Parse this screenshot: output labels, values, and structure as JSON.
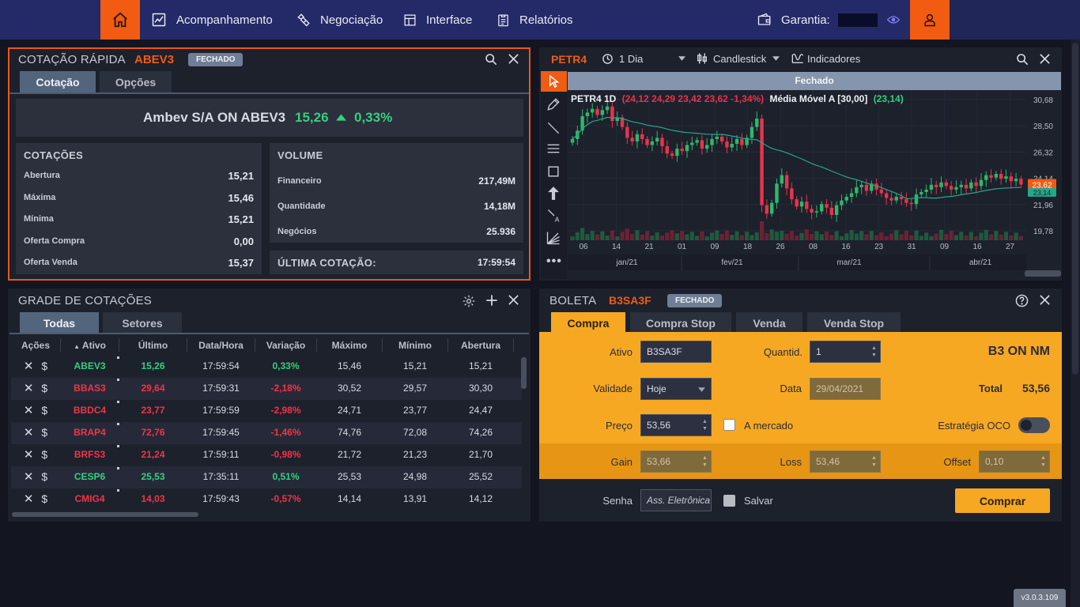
{
  "nav": {
    "items": [
      {
        "label": "Acompanhamento",
        "icon": "chart-icon"
      },
      {
        "label": "Negociação",
        "icon": "handshake-icon"
      },
      {
        "label": "Interface",
        "icon": "layout-icon"
      },
      {
        "label": "Relatórios",
        "icon": "report-icon"
      }
    ],
    "garantia_label": "Garantia:"
  },
  "quick_quote": {
    "title": "COTAÇÃO RÁPIDA",
    "ticker": "ABEV3",
    "status": "FECHADO",
    "tabs": [
      "Cotação",
      "Opções"
    ],
    "name": "Ambev S/A ON ABEV3",
    "price": "15,26",
    "change": "0,33%",
    "quotes_header": "COTAÇÕES",
    "quotes": [
      {
        "label": "Abertura",
        "value": "15,21"
      },
      {
        "label": "Máxima",
        "value": "15,46"
      },
      {
        "label": "Mínima",
        "value": "15,21"
      },
      {
        "label": "Oferta Compra",
        "value": "0,00"
      },
      {
        "label": "Oferta Venda",
        "value": "15,37"
      }
    ],
    "volume_header": "VOLUME",
    "volume": [
      {
        "label": "Financeiro",
        "value": "217,49M"
      },
      {
        "label": "Quantidade",
        "value": "14,18M"
      },
      {
        "label": "Negócios",
        "value": "25.936"
      }
    ],
    "last_label": "ÚLTIMA COTAÇÃO:",
    "last_time": "17:59:54"
  },
  "grid": {
    "title": "GRADE DE COTAÇÕES",
    "tabs": [
      "Todas",
      "Setores"
    ],
    "columns": [
      "Ações",
      "Ativo",
      "Último",
      "Data/Hora",
      "Variação",
      "Máximo",
      "Mínimo",
      "Abertura"
    ],
    "rows": [
      {
        "ativo": "ABEV3",
        "ultimo": "15,26",
        "hora": "17:59:54",
        "var": "0,33%",
        "max": "15,46",
        "min": "15,21",
        "abertura": "15,21",
        "dir": "pos"
      },
      {
        "ativo": "BBAS3",
        "ultimo": "29,64",
        "hora": "17:59:31",
        "var": "-2,18%",
        "max": "30,52",
        "min": "29,57",
        "abertura": "30,30",
        "dir": "neg"
      },
      {
        "ativo": "BBDC4",
        "ultimo": "23,77",
        "hora": "17:59:59",
        "var": "-2,98%",
        "max": "24,71",
        "min": "23,77",
        "abertura": "24,47",
        "dir": "neg"
      },
      {
        "ativo": "BRAP4",
        "ultimo": "72,76",
        "hora": "17:59:45",
        "var": "-1,46%",
        "max": "74,76",
        "min": "72,08",
        "abertura": "74,26",
        "dir": "neg"
      },
      {
        "ativo": "BRFS3",
        "ultimo": "21,24",
        "hora": "17:59:11",
        "var": "-0,98%",
        "max": "21,72",
        "min": "21,23",
        "abertura": "21,70",
        "dir": "neg"
      },
      {
        "ativo": "CESP6",
        "ultimo": "25,53",
        "hora": "17:35:11",
        "var": "0,51%",
        "max": "25,53",
        "min": "24,98",
        "abertura": "25,52",
        "dir": "pos"
      },
      {
        "ativo": "CMIG4",
        "ultimo": "14,03",
        "hora": "17:59:43",
        "var": "-0,57%",
        "max": "14,14",
        "min": "13,91",
        "abertura": "14,12",
        "dir": "neg"
      }
    ]
  },
  "chart": {
    "ticker": "PETR4",
    "interval": "1 Dia",
    "type": "Candlestick",
    "indicators": "Indicadores",
    "status": "Fechado",
    "legend_name": "PETR4 1D",
    "legend_values": "(24,12 24,29 23,42 23,62 -1,34%)",
    "ma_name": "Média Móvel A [30,00]",
    "ma_value": "(23,14)",
    "y_ticks": [
      "30,68",
      "28,50",
      "26,32",
      "24,14",
      "21,96",
      "19,78"
    ],
    "price_tag": "23,62",
    "ma_tag": "23,14",
    "x_ticks": [
      "06",
      "14",
      "21",
      "01",
      "09",
      "18",
      "26",
      "08",
      "16",
      "23",
      "31",
      "09",
      "16",
      "27"
    ],
    "months": [
      "jan/21",
      "fev/21",
      "mar/21",
      "abr/21"
    ],
    "colors": {
      "up": "#2fb86b",
      "down": "#e8334c",
      "ma": "#26a68d"
    }
  },
  "chart_data": {
    "type": "candlestick",
    "y_ticks": [
      30.68,
      28.5,
      26.32,
      24.14,
      21.96,
      19.78
    ],
    "ylim": [
      18.6,
      31.2
    ],
    "last": {
      "open": 24.12,
      "high": 24.29,
      "low": 23.42,
      "close": 23.62,
      "change_pct": -1.34
    },
    "moving_average": {
      "period": 30,
      "last": 23.14
    },
    "closes": [
      27.4,
      28.1,
      29.3,
      29.6,
      29.9,
      29.4,
      29.8,
      30.1,
      28.9,
      29.2,
      28.4,
      27.5,
      27.2,
      27.8,
      27.4,
      26.9,
      27.2,
      27.5,
      26.8,
      26.2,
      26.0,
      26.6,
      26.4,
      26.9,
      27.1,
      27.3,
      26.6,
      26.9,
      27.4,
      27.6,
      27.2,
      26.7,
      27.0,
      27.4,
      26.9,
      27.5,
      28.4,
      29.1,
      21.9,
      21.2,
      22.1,
      23.7,
      24.4,
      23.3,
      22.4,
      21.8,
      22.2,
      21.6,
      21.3,
      21.4,
      22.0,
      21.7,
      21.1,
      21.9,
      22.3,
      22.6,
      22.9,
      23.4,
      23.6,
      23.1,
      23.7,
      23.2,
      22.9,
      22.5,
      22.3,
      22.6,
      22.4,
      22.1,
      22.0,
      22.8,
      23.0,
      23.2,
      23.6,
      23.4,
      23.8,
      23.5,
      23.2,
      23.4,
      23.6,
      23.3,
      23.8,
      23.5,
      24.0,
      24.4,
      24.2,
      24.5,
      24.1,
      24.3,
      23.9,
      24.1,
      23.62
    ]
  },
  "boleta": {
    "title": "BOLETA",
    "ticker": "B3SA3F",
    "status": "FECHADO",
    "tabs": [
      "Compra",
      "Compra Stop",
      "Venda",
      "Venda Stop"
    ],
    "ativo_label": "Ativo",
    "ativo_value": "B3SA3F",
    "quant_label": "Quantid.",
    "quant_value": "1",
    "company": "B3 ON NM",
    "validade_label": "Validade",
    "validade_value": "Hoje",
    "data_label": "Data",
    "data_value": "29/04/2021",
    "total_label": "Total",
    "total_value": "53,56",
    "preco_label": "Preço",
    "preco_value": "53,56",
    "mercado_label": "A mercado",
    "oco_label": "Estratégia OCO",
    "gain_label": "Gain",
    "gain_value": "53,66",
    "loss_label": "Loss",
    "loss_value": "53,46",
    "offset_label": "Offset",
    "offset_value": "0,10",
    "senha_label": "Senha",
    "senha_placeholder": "Ass. Eletrônica",
    "salvar_label": "Salvar",
    "buy_label": "Comprar"
  },
  "version": "v3.0.3.109"
}
